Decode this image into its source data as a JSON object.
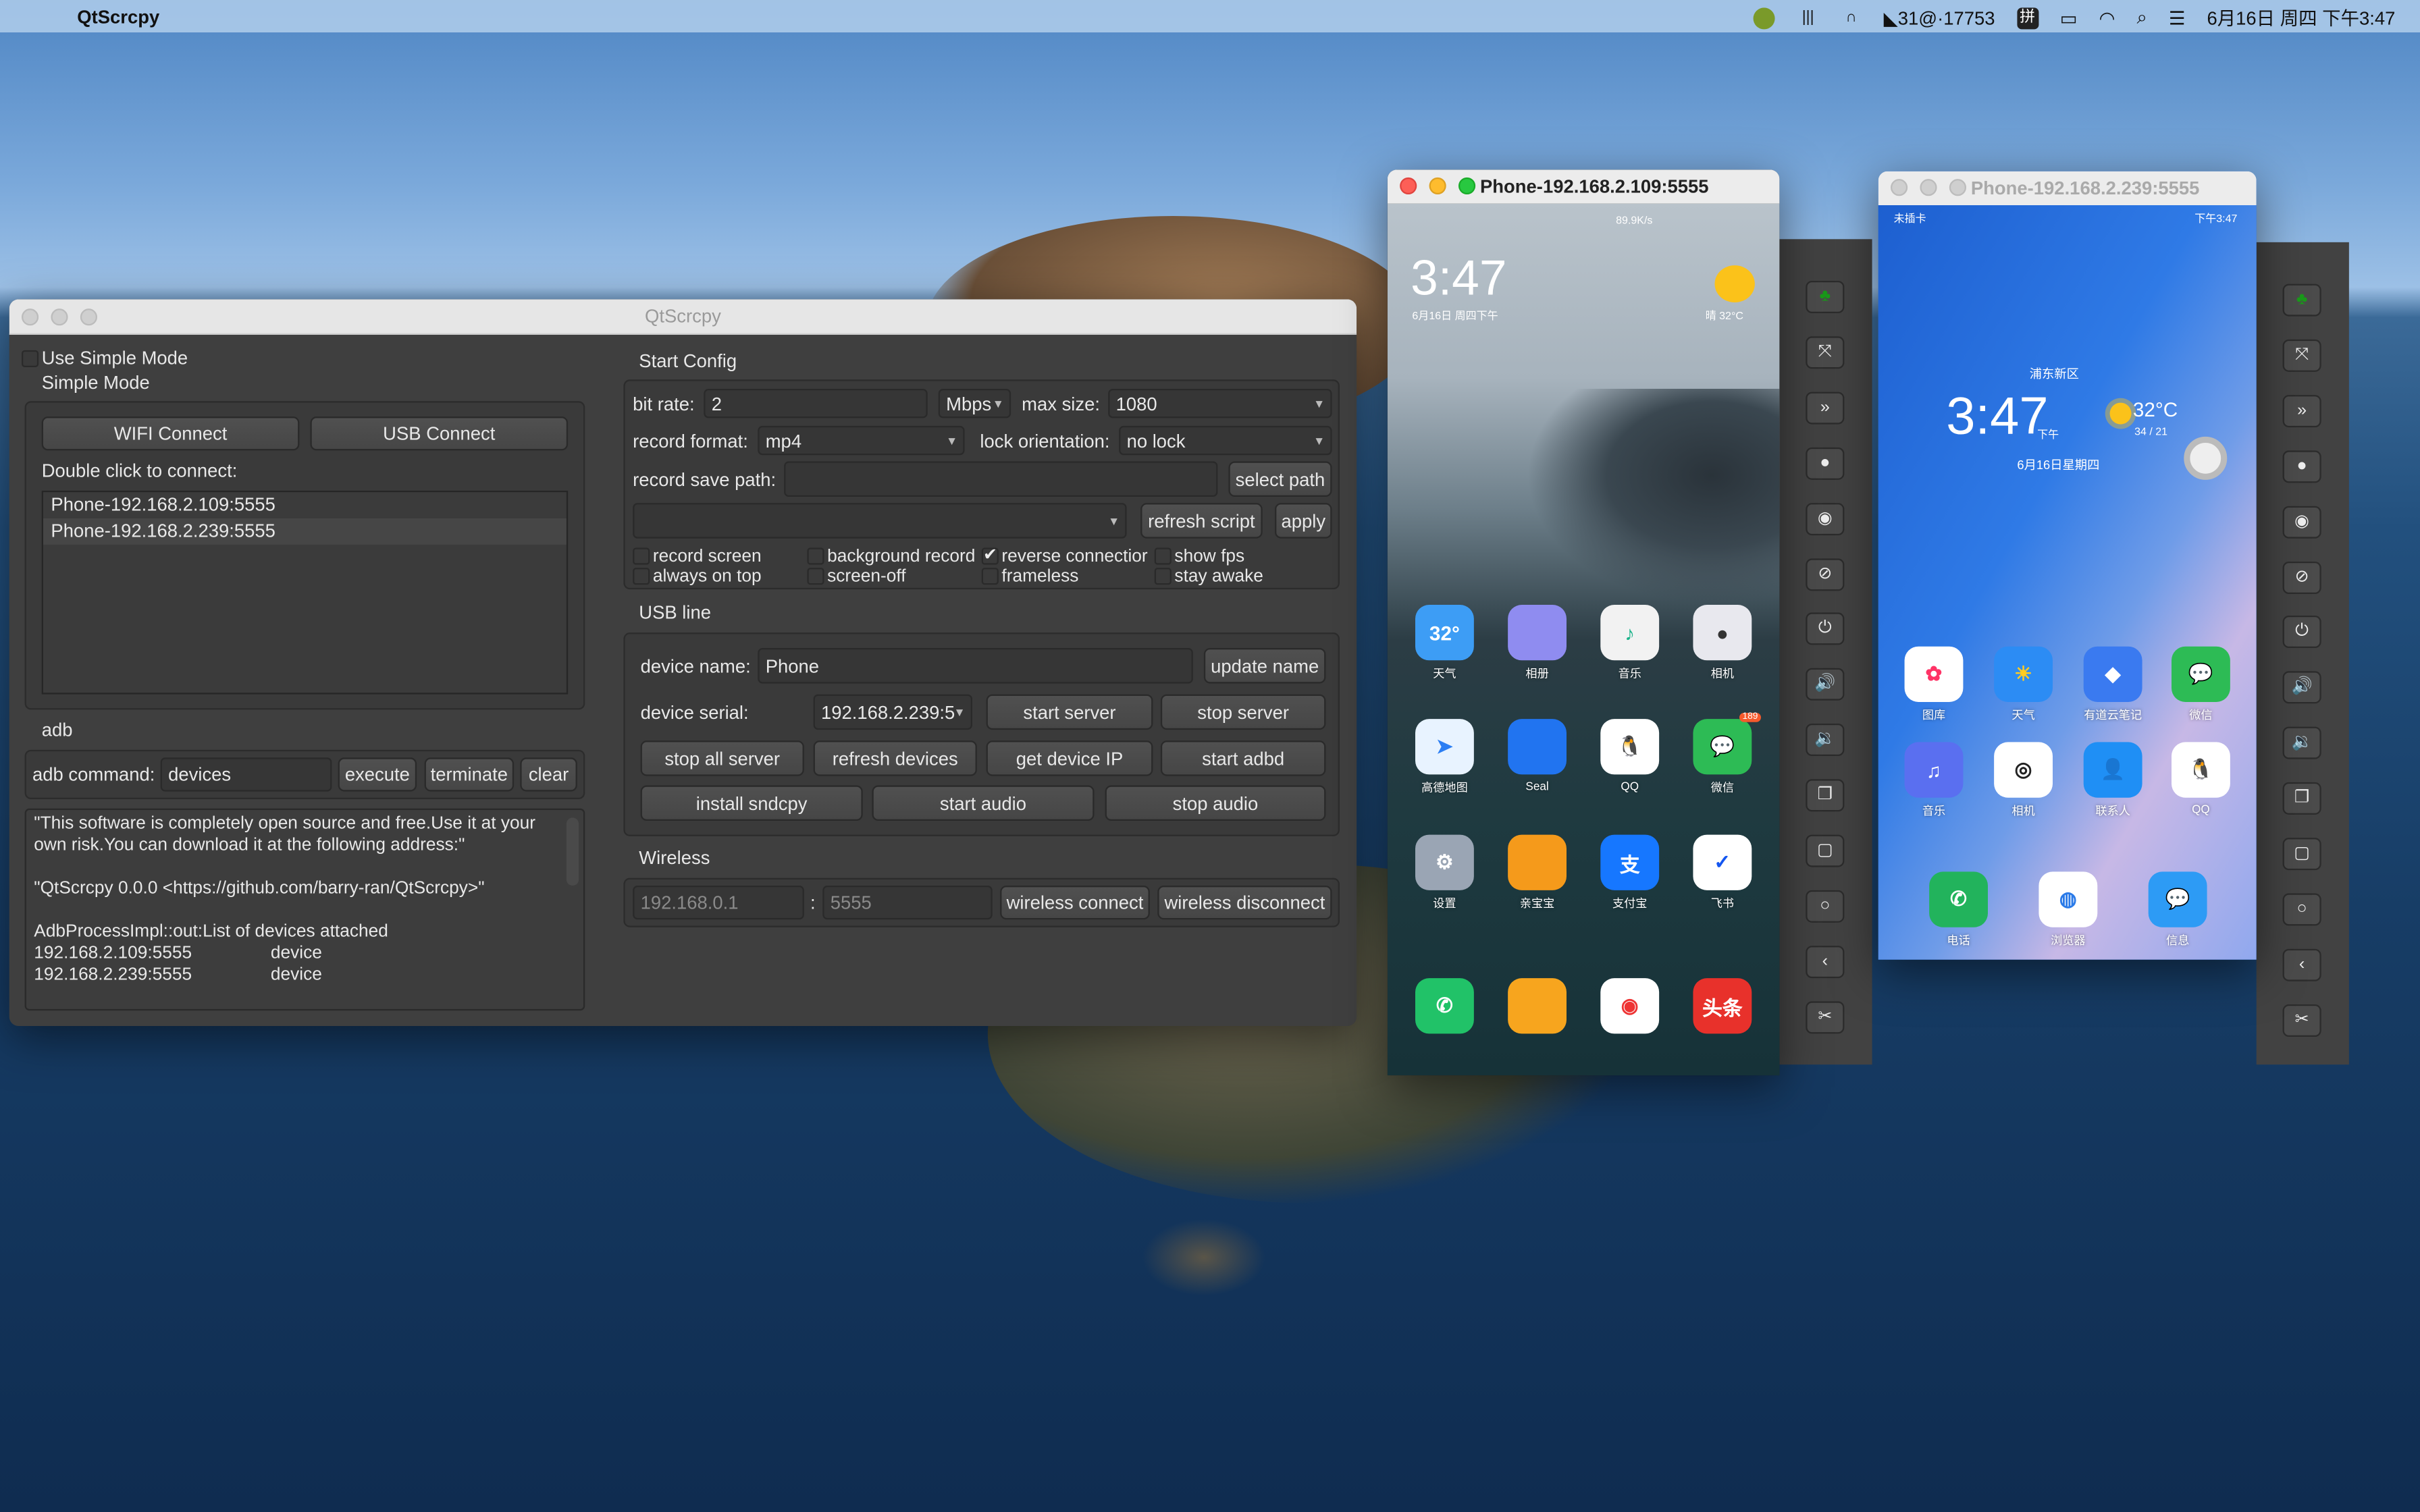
{
  "menubar": {
    "app_name": "QtScrcpy",
    "tray_text": "31@·17753",
    "ime": "拼",
    "datetime": "6月16日 周四 下午3:47"
  },
  "main_window": {
    "title": "QtScrcpy",
    "use_simple_mode": {
      "label": "Use Simple Mode",
      "checked": false
    },
    "simple_mode": {
      "title": "Simple Mode",
      "wifi_connect": "WIFI Connect",
      "usb_connect": "USB Connect",
      "hint": "Double click to connect:",
      "devices": [
        {
          "label": "Phone-192.168.2.109:5555",
          "selected": false
        },
        {
          "label": "Phone-192.168.2.239:5555",
          "selected": true
        }
      ]
    },
    "adb": {
      "title": "adb",
      "command_label": "adb command:",
      "command_value": "devices",
      "execute": "execute",
      "terminate": "terminate",
      "clear": "clear",
      "log": "\"This software is completely open source and free.Use it at your own risk.You can download it at the following address:\"\n\n\"QtScrcpy 0.0.0 <https://github.com/barry-ran/QtScrcpy>\"\n\nAdbProcessImpl::out:List of devices attached\n192.168.2.109:5555\t\tdevice\n192.168.2.239:5555\t\tdevice"
    },
    "start_config": {
      "title": "Start Config",
      "bit_rate_label": "bit rate:",
      "bit_rate_value": "2",
      "bit_rate_unit": "Mbps",
      "max_size_label": "max size:",
      "max_size_value": "1080",
      "record_format_label": "record format:",
      "record_format_value": "mp4",
      "lock_orientation_label": "lock orientation:",
      "lock_orientation_value": "no lock",
      "record_save_path_label": "record save path:",
      "record_save_path_value": "",
      "select_path": "select path",
      "script_value": "",
      "refresh_script": "refresh script",
      "apply": "apply",
      "options": [
        {
          "label": "record screen",
          "checked": false
        },
        {
          "label": "background record",
          "checked": false
        },
        {
          "label": "reverse connectior",
          "checked": true
        },
        {
          "label": "show fps",
          "checked": false
        },
        {
          "label": "always on top",
          "checked": false
        },
        {
          "label": "screen-off",
          "checked": false
        },
        {
          "label": "frameless",
          "checked": false
        },
        {
          "label": "stay awake",
          "checked": false
        }
      ]
    },
    "usb_line": {
      "title": "USB line",
      "device_name_label": "device name:",
      "device_name_value": "Phone",
      "update_name": "update name",
      "device_serial_label": "device serial:",
      "device_serial_value": "192.168.2.239:5",
      "start_server": "start server",
      "stop_server": "stop server",
      "stop_all_server": "stop all server",
      "refresh_devices": "refresh devices",
      "get_device_ip": "get device IP",
      "start_adbd": "start adbd",
      "install_sndcpy": "install sndcpy",
      "start_audio": "start audio",
      "stop_audio": "stop audio"
    },
    "wireless": {
      "title": "Wireless",
      "ip_placeholder": "192.168.0.1",
      "separator": ":",
      "port_placeholder": "5555",
      "connect": "wireless connect",
      "disconnect": "wireless disconnect"
    }
  },
  "toolbar_icons": [
    "keymap-icon",
    "fullscreen-icon",
    "expand-notification-icon",
    "screen-record-icon",
    "screen-on-icon",
    "screen-off-icon",
    "power-icon",
    "volume-up-icon",
    "volume-down-icon",
    "app-switch-icon",
    "menu-icon",
    "home-icon",
    "back-icon",
    "screenshot-icon"
  ],
  "phone1": {
    "title": "Phone-192.168.2.109:5555",
    "net_speed": "89.9K/s",
    "time": "3:47",
    "date": "6月16日 周四下午",
    "weather": "晴  32°C",
    "apps": [
      {
        "label": "天气",
        "color": "#3d9df5",
        "glyph": "32°"
      },
      {
        "label": "相册",
        "color": "#8f8cf0",
        "glyph": ""
      },
      {
        "label": "音乐",
        "color": "#f2f2f2",
        "glyph": "♪",
        "fg": "#1bb38a"
      },
      {
        "label": "相机",
        "color": "#e8e8ee",
        "glyph": "●",
        "fg": "#333"
      },
      {
        "label": "高德地图",
        "color": "#e8f3ff",
        "glyph": "➤",
        "fg": "#2b7ef3"
      },
      {
        "label": "Seal",
        "color": "#2174f0",
        "glyph": ""
      },
      {
        "label": "QQ",
        "color": "#ffffff",
        "glyph": "🐧",
        "fg": "#000"
      },
      {
        "label": "微信",
        "color": "#2dbb55",
        "glyph": "💬",
        "badge": "189"
      },
      {
        "label": "设置",
        "color": "#9aa5b4",
        "glyph": "⚙"
      },
      {
        "label": "亲宝宝",
        "color": "#f59a1b",
        "glyph": ""
      },
      {
        "label": "支付宝",
        "color": "#1677ff",
        "glyph": "支"
      },
      {
        "label": "飞书",
        "color": "#ffffff",
        "glyph": "✓",
        "fg": "#1456f0"
      }
    ],
    "dock": [
      {
        "color": "#21c268",
        "glyph": "✆"
      },
      {
        "color": "#f7a51e",
        "glyph": ""
      },
      {
        "color": "#ffffff",
        "glyph": "◉",
        "fg": "#e33"
      },
      {
        "color": "#e8312b",
        "glyph": "头条"
      }
    ]
  },
  "phone2": {
    "title": "Phone-192.168.2.239:5555",
    "carrier": "未插卡",
    "status_time": "下午3:47",
    "location": "浦东新区",
    "time": "3:47",
    "ampm": "下午",
    "temp": "32°C",
    "temp_range": "34 / 21",
    "date": "6月16日星期四",
    "apps": [
      {
        "label": "图库",
        "color": "#ffffff",
        "glyph": "✿",
        "fg": "#f36"
      },
      {
        "label": "天气",
        "color": "#2c8cf4",
        "glyph": "☀",
        "fg": "#ffcc22"
      },
      {
        "label": "有道云笔记",
        "color": "#3a7af0",
        "glyph": "◆"
      },
      {
        "label": "微信",
        "color": "#2dbb55",
        "glyph": "💬"
      },
      {
        "label": "音乐",
        "color": "#5a6ff0",
        "glyph": "♫"
      },
      {
        "label": "相机",
        "color": "#ffffff",
        "glyph": "◎",
        "fg": "#222"
      },
      {
        "label": "联系人",
        "color": "#1f8ff5",
        "glyph": "👤"
      },
      {
        "label": "QQ",
        "color": "#ffffff",
        "glyph": "🐧",
        "fg": "#000"
      }
    ],
    "dock": [
      {
        "label": "电话",
        "color": "#22b35c",
        "glyph": "✆"
      },
      {
        "label": "浏览器",
        "color": "#ffffff",
        "glyph": "◍",
        "fg": "#2a7ae8"
      },
      {
        "label": "信息",
        "color": "#2d9bf5",
        "glyph": "💬"
      }
    ]
  }
}
